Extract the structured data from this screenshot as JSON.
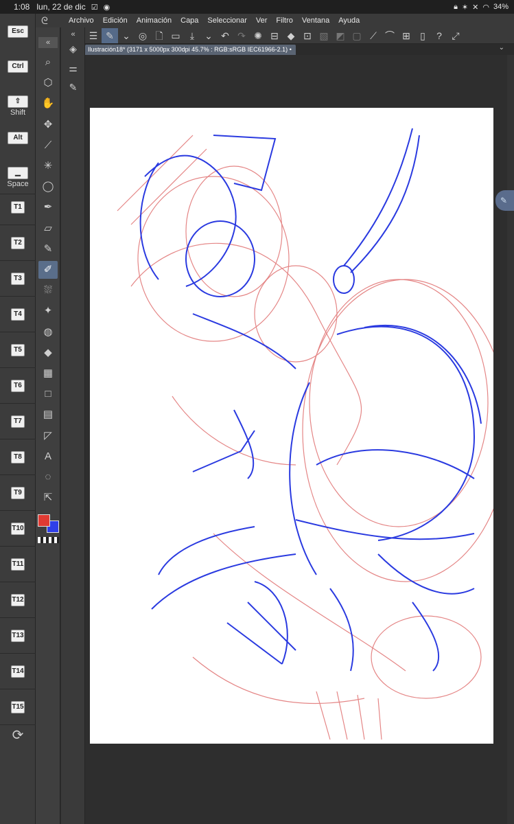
{
  "status_bar": {
    "time": "1:08",
    "date": "lun, 22 de dic",
    "battery": "34%"
  },
  "menu": [
    "Archivo",
    "Edición",
    "Animación",
    "Capa",
    "Seleccionar",
    "Ver",
    "Filtro",
    "Ventana",
    "Ayuda"
  ],
  "tab": {
    "title": "Ilustración18* (3171 x 5000px 300dpi 45.7% : RGB:sRGB IEC61966-2.1)"
  },
  "modifier_keys": {
    "esc": "Esc",
    "ctrl": "Ctrl",
    "shift_label": "Shift",
    "alt": "Alt",
    "space_label": "Space"
  },
  "custom_keys": [
    "T1",
    "T2",
    "T3",
    "T4",
    "T5",
    "T6",
    "T7",
    "T8",
    "T9",
    "T10",
    "T11",
    "T12",
    "T13",
    "T14",
    "T15"
  ],
  "tools": [
    {
      "name": "zoom-icon",
      "glyph": "⌕"
    },
    {
      "name": "operation-icon",
      "glyph": "⬡"
    },
    {
      "name": "hand-icon",
      "glyph": "✋"
    },
    {
      "name": "move-icon",
      "glyph": "✥"
    },
    {
      "name": "eyedropper-icon",
      "glyph": "⟋"
    },
    {
      "name": "magic-wand-icon",
      "glyph": "✳"
    },
    {
      "name": "lasso-icon",
      "glyph": "◯"
    },
    {
      "name": "pen-icon",
      "glyph": "✒"
    },
    {
      "name": "eraser-icon",
      "glyph": "▱"
    },
    {
      "name": "brush-icon",
      "glyph": "✎"
    },
    {
      "name": "pencil-icon",
      "glyph": "✐",
      "active": true
    },
    {
      "name": "airbrush-icon",
      "glyph": "⛆"
    },
    {
      "name": "decoration-icon",
      "glyph": "✦"
    },
    {
      "name": "blend-icon",
      "glyph": "◍"
    },
    {
      "name": "fill-icon",
      "glyph": "◆"
    },
    {
      "name": "gradient-icon",
      "glyph": "▦"
    },
    {
      "name": "shape-icon",
      "glyph": "□"
    },
    {
      "name": "frame-icon",
      "glyph": "▤"
    },
    {
      "name": "ruler-icon",
      "glyph": "◸"
    },
    {
      "name": "text-icon",
      "glyph": "A"
    },
    {
      "name": "balloon-icon",
      "glyph": "◌"
    },
    {
      "name": "correct-line-icon",
      "glyph": "⇱"
    }
  ],
  "colors": {
    "main": "#e03a32",
    "sub": "#2f3fe8"
  }
}
